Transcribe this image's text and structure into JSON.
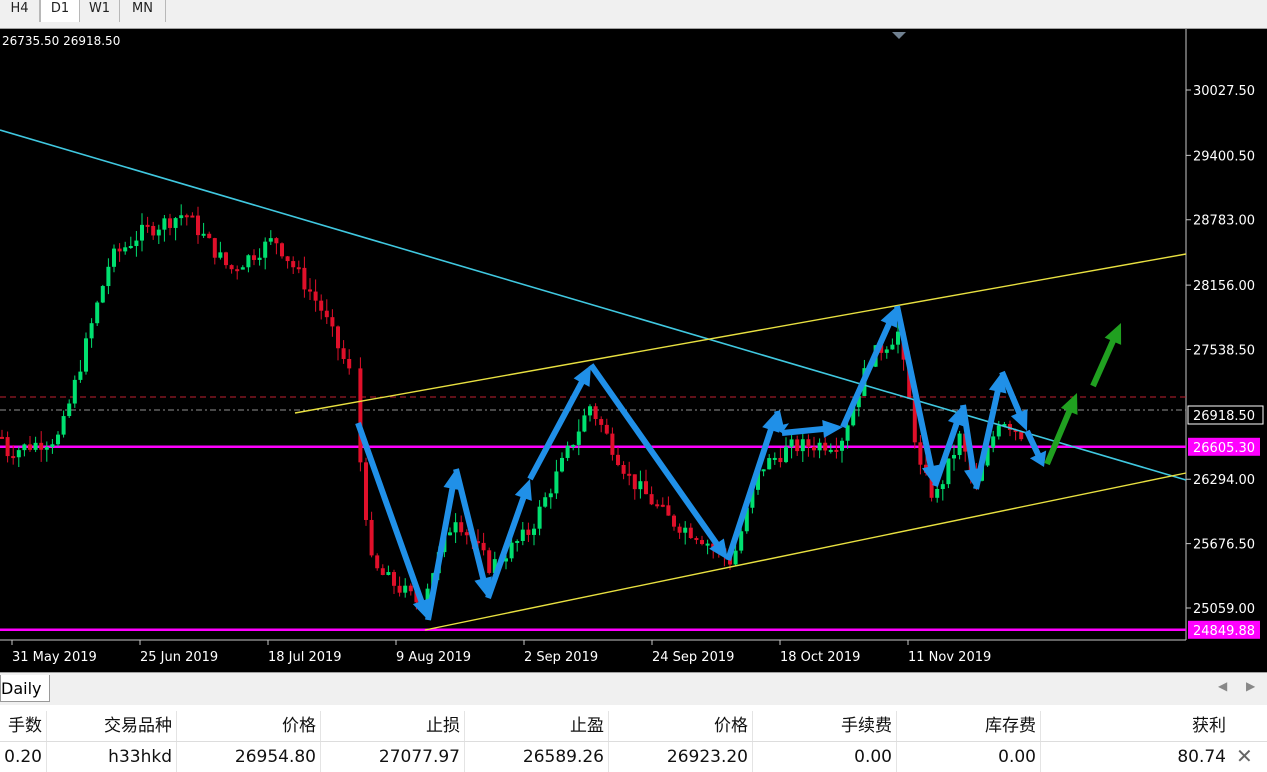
{
  "timeframes": [
    "H4",
    "D1",
    "W1",
    "MN"
  ],
  "ohlc_text": "26735.50 26918.50",
  "price_labels": [
    {
      "text": "30027.50",
      "value": 30027.5
    },
    {
      "text": "29400.50",
      "value": 29400.5
    },
    {
      "text": "28783.00",
      "value": 28783.0
    },
    {
      "text": "28156.00",
      "value": 28156.0
    },
    {
      "text": "27538.50",
      "value": 27538.5
    },
    {
      "text": "26294.00",
      "value": 26294.0
    },
    {
      "text": "25676.50",
      "value": 25676.5
    },
    {
      "text": "25059.00",
      "value": 25059.0
    }
  ],
  "current_price": {
    "text": "26918.50",
    "value": 26918.5
  },
  "level_upper": {
    "text": "26605.30",
    "value": 26605.3,
    "color": "#ff00ff"
  },
  "level_lower": {
    "text": "24849.88",
    "value": 24849.88,
    "color": "#ff00ff"
  },
  "date_labels": [
    "31 May 2019",
    "25 Jun 2019",
    "18 Jul 2019",
    "9 Aug 2019",
    "2 Sep 2019",
    "24 Sep 2019",
    "18 Oct 2019",
    "11 Nov 2019"
  ],
  "tab_label": "Daily",
  "columns": [
    "手数",
    "交易品种",
    "价格",
    "止损",
    "止盈",
    "价格",
    "手续费",
    "库存费",
    "获利"
  ],
  "row": [
    "0.20",
    "h33hkd",
    "26954.80",
    "27077.97",
    "26589.26",
    "26923.20",
    "0.00",
    "0.00",
    "80.74"
  ],
  "colors": {
    "bull": "#00e070",
    "bear": "#e0102a",
    "trendline": "#40c8e0",
    "channel": "#e8e040",
    "arrow_blue": "#2090e8",
    "arrow_green": "#20a020"
  }
}
